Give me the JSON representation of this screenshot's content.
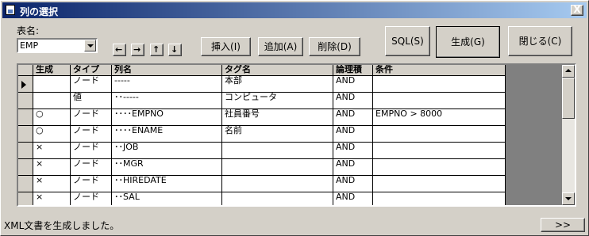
{
  "window": {
    "title": "列の選択",
    "close_label": "X"
  },
  "table_selector": {
    "label": "表名:",
    "value": "EMP"
  },
  "move_buttons": [
    "←",
    "→",
    "↑",
    "↓"
  ],
  "row_buttons": {
    "insert": "挿入(I)",
    "add": "追加(A)",
    "delete": "削除(D)"
  },
  "action_buttons": {
    "sql": "SQL(S)",
    "generate": "生成(G)",
    "close": "閉じる(C)"
  },
  "grid": {
    "headers": [
      "生成",
      "タイプ",
      "列名",
      "タグ名",
      "論理積",
      "条件"
    ],
    "rows": [
      [
        "",
        "ノード",
        "-----",
        "本部",
        "AND",
        ""
      ],
      [
        "",
        "値",
        "･･-----",
        "コンピュータ",
        "AND",
        ""
      ],
      [
        "○",
        "ノード",
        "････EMPNO",
        "社員番号",
        "AND",
        "EMPNO > 8000"
      ],
      [
        "○",
        "ノード",
        "････ENAME",
        "名前",
        "AND",
        ""
      ],
      [
        "×",
        "ノード",
        "･･JOB",
        "",
        "AND",
        ""
      ],
      [
        "×",
        "ノード",
        "･･MGR",
        "",
        "AND",
        ""
      ],
      [
        "×",
        "ノード",
        "･･HIREDATE",
        "",
        "AND",
        ""
      ],
      [
        "×",
        "ノード",
        "･･SAL",
        "",
        "AND",
        ""
      ]
    ]
  },
  "status": {
    "message": "XML文書を生成しました。",
    "next_button": ">>"
  }
}
